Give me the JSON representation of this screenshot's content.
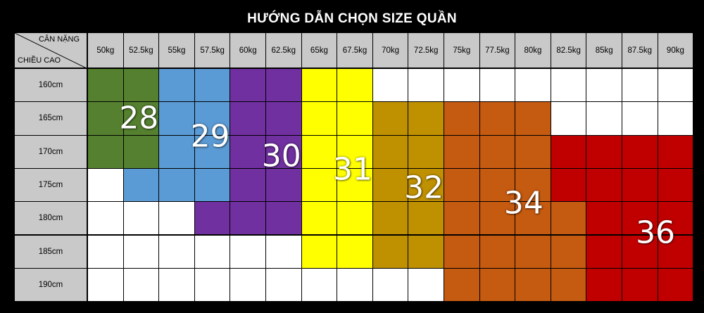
{
  "title": "HƯỚNG DẪN CHỌN SIZE QUẦN",
  "corner": {
    "weight_label": "CÂN NẶNG",
    "height_label": "CHIỀU CAO"
  },
  "weights": [
    "50kg",
    "52.5kg",
    "55kg",
    "57.5kg",
    "60kg",
    "62.5kg",
    "65kg",
    "67.5kg",
    "70kg",
    "72.5kg",
    "75kg",
    "77.5kg",
    "80kg",
    "82.5kg",
    "85kg",
    "87.5kg",
    "90kg"
  ],
  "heights": [
    "160cm",
    "165cm",
    "170cm",
    "175cm",
    "180cm",
    "185cm",
    "190cm"
  ],
  "colors": {
    "28": "#55802f",
    "29": "#5b9bd5",
    "30": "#7030a0",
    "31": "#ffff00",
    "32": "#bf9000",
    "34": "#c55a11",
    "36": "#c00000",
    "empty": "#ffffff"
  },
  "size_grid": [
    [
      "28",
      "28",
      "29",
      "29",
      "30",
      "30",
      "31",
      "31",
      "",
      "",
      "",
      "",
      "",
      "",
      "",
      "",
      ""
    ],
    [
      "28",
      "28",
      "29",
      "29",
      "30",
      "30",
      "31",
      "31",
      "32",
      "32",
      "34",
      "34",
      "34",
      "",
      "",
      "",
      ""
    ],
    [
      "28",
      "28",
      "29",
      "29",
      "30",
      "30",
      "31",
      "31",
      "32",
      "32",
      "34",
      "34",
      "34",
      "36",
      "36",
      "36",
      "36"
    ],
    [
      "",
      "29",
      "29",
      "29",
      "30",
      "30",
      "31",
      "31",
      "32",
      "32",
      "34",
      "34",
      "34",
      "36",
      "36",
      "36",
      "36"
    ],
    [
      "",
      "",
      "",
      "30",
      "30",
      "30",
      "31",
      "31",
      "32",
      "32",
      "34",
      "34",
      "34",
      "34",
      "36",
      "36",
      "36"
    ],
    [
      "",
      "",
      "",
      "",
      "",
      "",
      "31",
      "31",
      "32",
      "32",
      "34",
      "34",
      "34",
      "34",
      "36",
      "36",
      "36"
    ],
    [
      "",
      "",
      "",
      "",
      "",
      "",
      "",
      "",
      "",
      "",
      "34",
      "34",
      "34",
      "34",
      "36",
      "36",
      "36"
    ]
  ],
  "size_labels": [
    {
      "text": "28",
      "row": 1.0,
      "col": 0.95
    },
    {
      "text": "29",
      "row": 1.55,
      "col": 2.95
    },
    {
      "text": "30",
      "row": 2.15,
      "col": 4.95
    },
    {
      "text": "31",
      "row": 2.55,
      "col": 6.95
    },
    {
      "text": "32",
      "row": 3.1,
      "col": 8.95
    },
    {
      "text": "34",
      "row": 3.55,
      "col": 11.75
    },
    {
      "text": "36",
      "row": 4.45,
      "col": 15.45
    }
  ]
}
